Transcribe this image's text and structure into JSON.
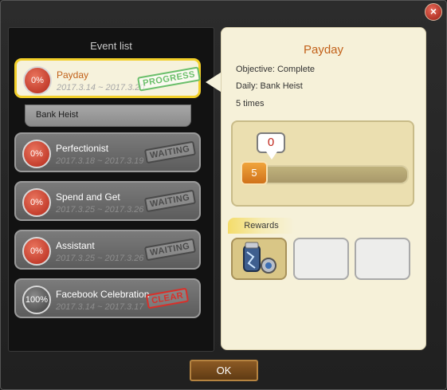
{
  "close_label": "×",
  "event_list": {
    "title": "Event list",
    "events": [
      {
        "percent": "0%",
        "name": "Payday",
        "dates": "2017.3.14 ~ 2017.3.20",
        "status": "PROGRESS",
        "selected": true
      },
      {
        "percent": "0%",
        "name": "Perfectionist",
        "dates": "2017.3.18 ~ 2017.3.19",
        "status": "WAITING"
      },
      {
        "percent": "0%",
        "name": "Spend and Get",
        "dates": "2017.3.25 ~ 2017.3.26",
        "status": "WAITING"
      },
      {
        "percent": "0%",
        "name": "Assistant",
        "dates": "2017.3.25 ~ 2017.3.26",
        "status": "WAITING"
      },
      {
        "percent": "100%",
        "name": "Facebook Celebration",
        "dates": "2017.3.14 ~ 2017.3.17",
        "status": "CLEAR"
      }
    ],
    "sub_item": "Bank Heist"
  },
  "detail": {
    "title": "Payday",
    "objective": "Objective: Complete",
    "daily": "Daily: Bank Heist",
    "times": "5 times",
    "progress_current": "0",
    "progress_goal": "5",
    "progress_fraction": 0.0,
    "rewards_label": "Rewards"
  },
  "ok_label": "OK",
  "colors": {
    "selected_border": "#f2cf29",
    "progress_stamp": "#6bbf6b",
    "clear_stamp": "#d8302a",
    "title_orange": "#c2611a"
  }
}
